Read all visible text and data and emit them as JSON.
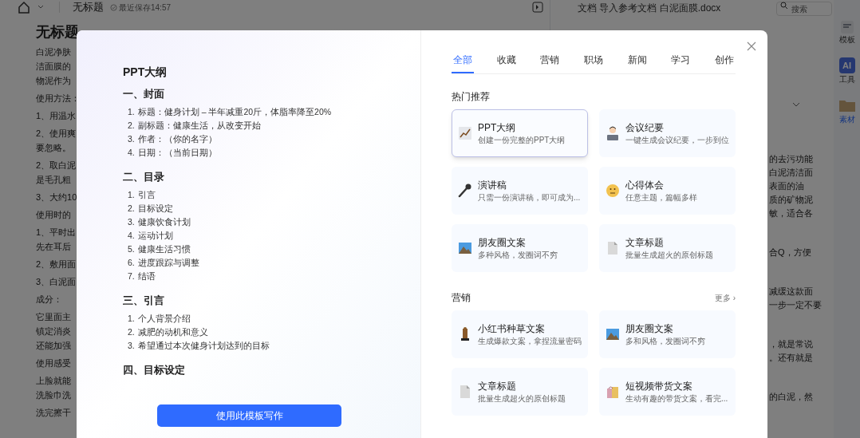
{
  "topbar": {
    "title": "无标题",
    "save_status": "最近保存14:57",
    "doc_path": "文档 导入参考文档 白泥面膜.docx",
    "search": {
      "placeholder": "搜索"
    }
  },
  "document": {
    "heading": "无标题",
    "paragraphs": [
      [
        "白泥净肤",
        "洁面膜的",
        "物泥作为"
      ],
      [
        "使用方法："
      ],
      [
        "1、用温水"
      ],
      [
        "2、使用爽",
        "要忽略。"
      ],
      [
        "2、取白泥",
        "是毛孔粗"
      ],
      [
        "3、大约10"
      ],
      [
        "使用时的"
      ],
      [
        "1、平时出",
        "先在耳后"
      ],
      [
        "2、敷用面"
      ],
      [
        "3、白泥面"
      ],
      [
        "成分："
      ],
      [
        "它里面主",
        "镇定消炎",
        "还能加强"
      ],
      [
        "使用感受"
      ],
      [
        "上脸就能",
        "洗脸巾洗"
      ],
      [
        "洗完擦干"
      ]
    ],
    "right_paragraphs": [
      [
        "的去污功能",
        "白泥清洁面",
        "表面的油",
        "质的矿物泥",
        "敏，适合各"
      ],
      [
        "合Q，方便"
      ],
      [
        "减缓这款面",
        "一步一定不要"
      ],
      [
        "，就是常说",
        "。还有就是"
      ],
      [
        "的白泥，然"
      ]
    ]
  },
  "right_sidebar": [
    {
      "kind": "template",
      "label": "模板",
      "selected": false
    },
    {
      "kind": "ai",
      "badge": "AI",
      "label": "工具",
      "selected": false
    },
    {
      "kind": "folder",
      "label": "素材",
      "selected": true
    }
  ],
  "modal": {
    "preview": {
      "title": "PPT大纲",
      "sections": [
        {
          "heading": "一、封面",
          "items": [
            {
              "number": "1.",
              "text": "标题：健身计划 – 半年减重20斤，体脂率降至20%"
            },
            {
              "number": "2.",
              "text": "副标题：健康生活，从改变开始"
            },
            {
              "number": "3.",
              "text": "作者：（你的名字）"
            },
            {
              "number": "4.",
              "text": "日期：（当前日期）"
            }
          ]
        },
        {
          "heading": "二、目录",
          "items": [
            {
              "number": "1.",
              "text": "引言"
            },
            {
              "number": "2.",
              "text": "目标设定"
            },
            {
              "number": "3.",
              "text": "健康饮食计划"
            },
            {
              "number": "4.",
              "text": "运动计划"
            },
            {
              "number": "5.",
              "text": "健康生活习惯"
            },
            {
              "number": "6.",
              "text": "进度跟踪与调整"
            },
            {
              "number": "7.",
              "text": "结语"
            }
          ]
        },
        {
          "heading": "三、引言",
          "items": [
            {
              "number": "1.",
              "text": "个人背景介绍"
            },
            {
              "number": "2.",
              "text": "减肥的动机和意义"
            },
            {
              "number": "3.",
              "text": "希望通过本次健身计划达到的目标"
            }
          ]
        },
        {
          "heading": "四、目标设定"
        }
      ]
    },
    "use_button": "使用此模板写作",
    "tabs": [
      {
        "label": "全部",
        "selected": true
      },
      {
        "label": "收藏",
        "selected": false
      },
      {
        "label": "营销",
        "selected": false
      },
      {
        "label": "职场",
        "selected": false
      },
      {
        "label": "新闻",
        "selected": false
      },
      {
        "label": "学习",
        "selected": false
      },
      {
        "label": "创作",
        "selected": false
      }
    ],
    "groups": [
      {
        "title": "热门推荐",
        "cards": [
          {
            "kind": "chart",
            "title": "PPT大纲",
            "desc": "创建一份完整的PPT大纲",
            "selected": true
          },
          {
            "kind": "meeting",
            "title": "会议纪要",
            "desc": "一键生成会议纪要，一步到位",
            "selected": false
          },
          {
            "kind": "mic",
            "title": "演讲稿",
            "desc": "只需一份演讲稿，即可成为...",
            "selected": false
          },
          {
            "kind": "thinking",
            "title": "心得体会",
            "desc": "任意主题，篇幅多样",
            "selected": false
          },
          {
            "kind": "photo",
            "title": "朋友圈文案",
            "desc": "多种风格，发圈词不穷",
            "selected": false
          },
          {
            "kind": "doc",
            "title": "文章标题",
            "desc": "批量生成超火的原创标题",
            "selected": false
          }
        ]
      },
      {
        "title": "营销",
        "more": "更多 ›",
        "cards": [
          {
            "kind": "statue",
            "title": "小红书种草文案",
            "desc": "生成爆款文案，拿捏流量密码",
            "selected": false
          },
          {
            "kind": "photo",
            "title": "朋友圈文案",
            "desc": "多和风格，发圈词不穷",
            "selected": false
          },
          {
            "kind": "doc",
            "title": "文章标题",
            "desc": "批量生成超火的原创标题",
            "selected": false
          },
          {
            "kind": "bags",
            "title": "短视频带货文案",
            "desc": "生动有趣的带货文案，看完...",
            "selected": false
          }
        ]
      }
    ]
  }
}
